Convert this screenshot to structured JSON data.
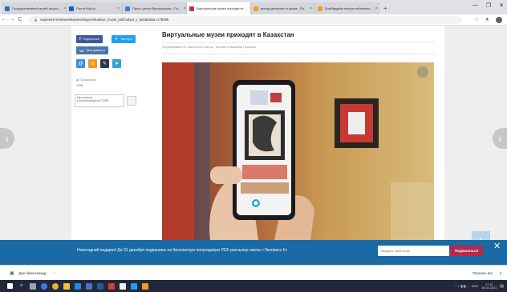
{
  "browser": {
    "tabs": [
      {
        "title": "Государственный музей искусс...",
        "color": "#2e6cc4",
        "active": false
      },
      {
        "title": "Почта Mail.ru",
        "color": "#1f5fb4",
        "active": false
      },
      {
        "title": "Пресс-релиз Виртуальная - По...",
        "color": "#3d7be0",
        "active": false
      },
      {
        "title": "Виртуальные музеи приходят в ...",
        "color": "#c9323e",
        "active": true
      },
      {
        "title": "выезд-материал в архив - По...",
        "color": "#f2a020",
        "active": false
      },
      {
        "title": "Бомбардейн витрин публичны...",
        "color": "#f2a020",
        "active": false
      }
    ],
    "newtab": "+",
    "window_controls": [
      "—",
      "❐",
      "✕"
    ],
    "url": "express-k.kz/news/ekspress/kaye/virtualnye_muzei_prikhodyat_v_kazakhstan-179395",
    "nav": [
      "←",
      "→",
      "C"
    ],
    "right_icons": [
      "☆",
      "★"
    ]
  },
  "sidebar": {
    "facebook": "Поделиться",
    "twitter": "Твитнуть",
    "vk": "Мне нравится",
    "views_label": "Просмотров",
    "views": "1338",
    "short_link": "http://express-k.kz/news/ekspress/179395"
  },
  "article": {
    "title": "Виртуальные музеи приходят в Казахстан",
    "meta": "Опубликовано 02 Марта 2021    Автор: Татьяна КЛЫШЕВА | Алматы"
  },
  "banner": {
    "text": "Новогодний подарок! До 31 декабря подпишись на бесплатную полугодовую PDF-рассылку газеты «Экспресс К»",
    "email_placeholder": "Введите свой email",
    "subscribe": "Подписаться",
    "close": "✕"
  },
  "download": {
    "file": "Дин бизнесменду",
    "show_all": "Показать все",
    "close": "✕"
  },
  "taskbar": {
    "time": "17:12",
    "date": "26.02.2021",
    "lang": "ENG"
  },
  "colors": {
    "facebook": "#3b5998",
    "twitter": "#1da1f2",
    "vk": "#4a76a8",
    "banner": "#1a6aa6",
    "subscribe": "#b42a4b"
  }
}
